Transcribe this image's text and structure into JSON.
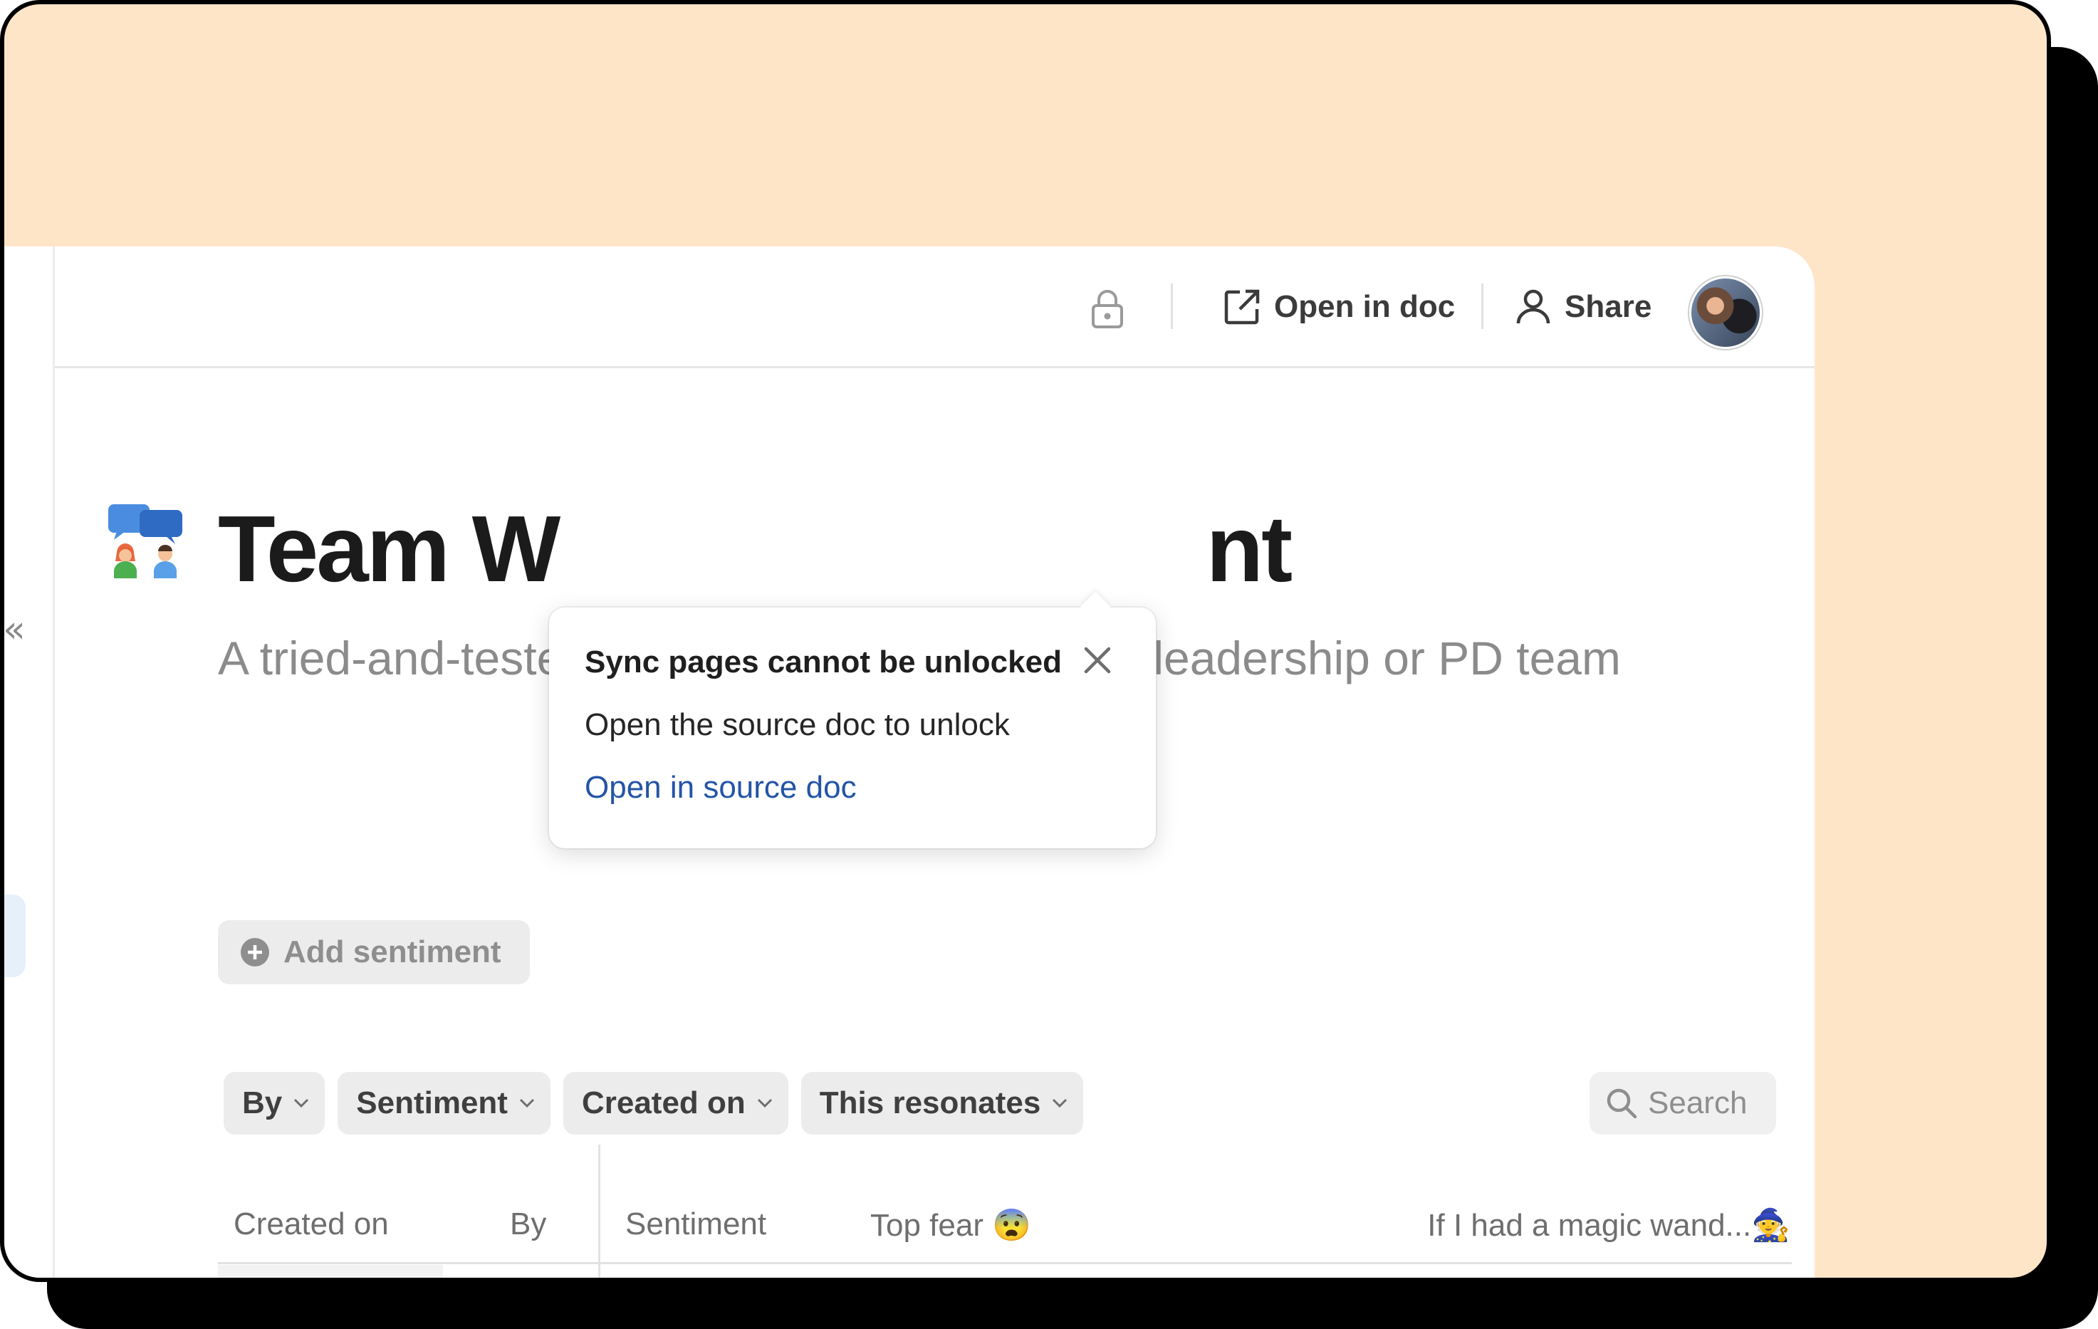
{
  "toolbar": {
    "lock_icon": "lock-icon",
    "open_in_doc_label": "Open in doc",
    "share_label": "Share"
  },
  "page": {
    "title": "Team W",
    "title_tail": "nt",
    "subtitle": "A tried-and-tested way to surface issues in a leadership or PD team"
  },
  "actions": {
    "add_sentiment_label": "Add sentiment"
  },
  "filters": [
    {
      "label": "By"
    },
    {
      "label": "Sentiment"
    },
    {
      "label": "Created on"
    },
    {
      "label": "This resonates"
    }
  ],
  "search": {
    "placeholder": "Search"
  },
  "table": {
    "columns": [
      "Created on",
      "By",
      "Sentiment",
      "Top fear 😨",
      "If I had a magic wand...🧙"
    ]
  },
  "popover": {
    "title": "Sync pages cannot be unlocked",
    "body": "Open the source doc to unlock",
    "link": "Open in source doc"
  },
  "colors": {
    "frame_background": "#ffe5c8",
    "link": "#2454a6"
  }
}
